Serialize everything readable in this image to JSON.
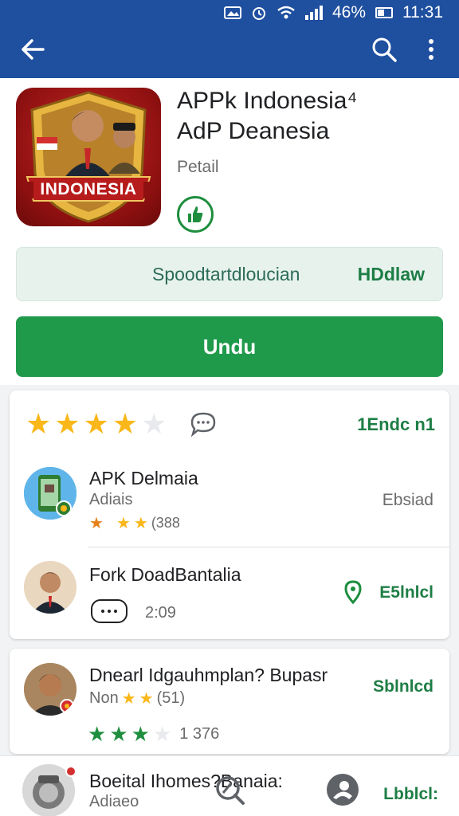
{
  "status_bar": {
    "battery_percent": "46%",
    "time": "11:31"
  },
  "app_bar": {
    "back_icon": "arrow-back-icon",
    "search_icon": "search-icon",
    "more_icon": "more-vert-icon"
  },
  "app": {
    "icon_text": "INDONESIA",
    "title_line1": "APPk Indonesia⁴",
    "title_line2": "AdP Deanesia",
    "subtitle": "Petail",
    "badge_icon": "thumbs-up-icon"
  },
  "info_box": {
    "left_text": "Spoodtartdloucian",
    "right_text": "HDdlaw"
  },
  "install_button": {
    "label": "Undu"
  },
  "rating_card": {
    "rating_value": 4,
    "rating_max": 5,
    "right_text": "1Endc n1",
    "items": [
      {
        "title": "APK Delmaia",
        "subtitle": "Adiais",
        "count_text": "(388",
        "right_text": "Ebsiad"
      },
      {
        "title": "Fork DoadBantalia",
        "time_text": "2:09",
        "right_text": "E5lnlcl"
      }
    ]
  },
  "review_card": {
    "title": "Dnearl Idgauhmplan? Bupasr",
    "subtitle": "Non",
    "subtitle_count": "(51)",
    "right_text": "Sblnlcd",
    "rating_value": 3,
    "rating_max": 4,
    "count_text": "1 376"
  },
  "bottom_item": {
    "title": "Boeital Ihomes?Banaia:",
    "subtitle": "Adiaeo",
    "right_text": "Lbblcl:",
    "colors": {
      "accent": "#1f9a4b",
      "app_bar": "#1f4f9f",
      "star": "#f9b719"
    }
  }
}
